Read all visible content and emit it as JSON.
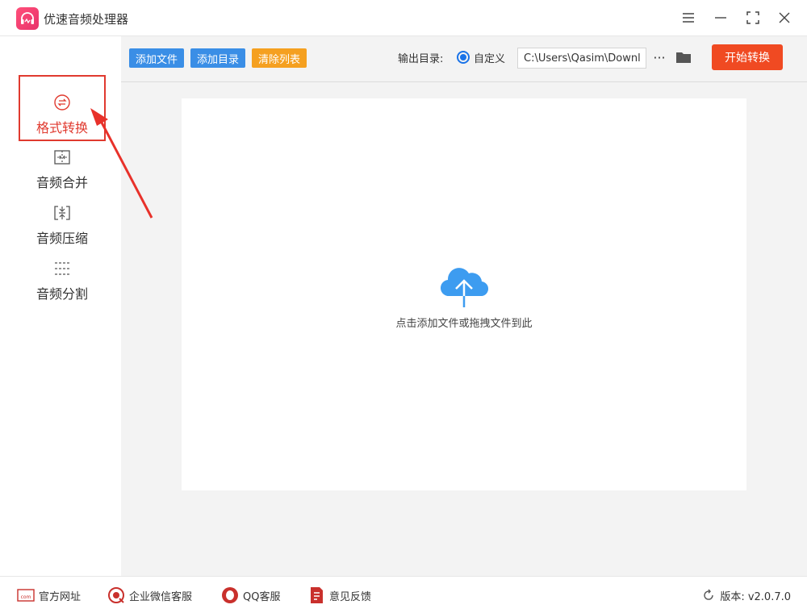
{
  "app": {
    "title": "优速音频处理器"
  },
  "window": {
    "menu": "menu-icon",
    "minimize": "minimize-icon",
    "maximize": "maximize-icon",
    "close": "close-icon"
  },
  "sidebar": {
    "items": [
      {
        "label": "格式转换",
        "icon": "format-convert-icon",
        "active": true
      },
      {
        "label": "音频合并",
        "icon": "audio-merge-icon"
      },
      {
        "label": "音频压缩",
        "icon": "audio-compress-icon"
      },
      {
        "label": "音频分割",
        "icon": "audio-split-icon"
      }
    ]
  },
  "toolbar": {
    "add_file": "添加文件",
    "add_folder": "添加目录",
    "clear_list": "清除列表",
    "output_label": "输出目录:",
    "custom_option": "自定义",
    "output_path": "C:\\Users\\Qasim\\Downloads",
    "more": "···",
    "start": "开始转换"
  },
  "dropzone": {
    "text": "点击添加文件或拖拽文件到此"
  },
  "footer": {
    "links": [
      {
        "label": "官方网址",
        "icon": "website-icon"
      },
      {
        "label": "企业微信客服",
        "icon": "wechat-service-icon"
      },
      {
        "label": "QQ客服",
        "icon": "qq-icon"
      },
      {
        "label": "意见反馈",
        "icon": "feedback-icon"
      }
    ],
    "version": "版本: v2.0.7.0"
  },
  "colors": {
    "accent": "#e03a2f",
    "primary_blue": "#3a8ee6",
    "orange": "#f5a020",
    "start_red": "#f04a22"
  }
}
